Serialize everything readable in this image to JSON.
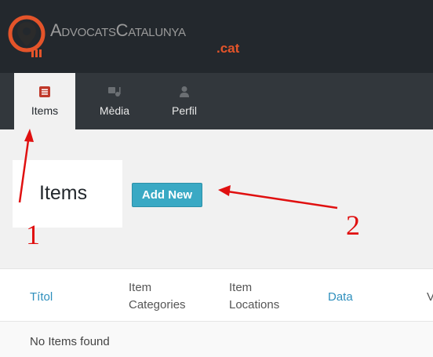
{
  "brand": {
    "name": "AdvocatsCatalunya",
    "tld": ".cat",
    "accent_color": "#e4542a",
    "icon": "location-pin-icon"
  },
  "tabs": [
    {
      "label": "Items",
      "icon": "items-icon",
      "active": true
    },
    {
      "label": "Mèdia",
      "icon": "media-icon",
      "active": false
    },
    {
      "label": "Perfil",
      "icon": "user-icon",
      "active": false
    }
  ],
  "main": {
    "title": "Items",
    "add_new_label": "Add New"
  },
  "table": {
    "columns": [
      {
        "line1": "Títol",
        "line2": ""
      },
      {
        "line1": "Item",
        "line2": "Categories"
      },
      {
        "line1": "Item",
        "line2": "Locations"
      },
      {
        "line1": "Data",
        "line2": ""
      },
      {
        "line1": "V",
        "line2": ""
      }
    ],
    "empty_message": "No Items found"
  },
  "annotations": {
    "marker_1": "1",
    "marker_2": "2",
    "color": "#e01010"
  }
}
